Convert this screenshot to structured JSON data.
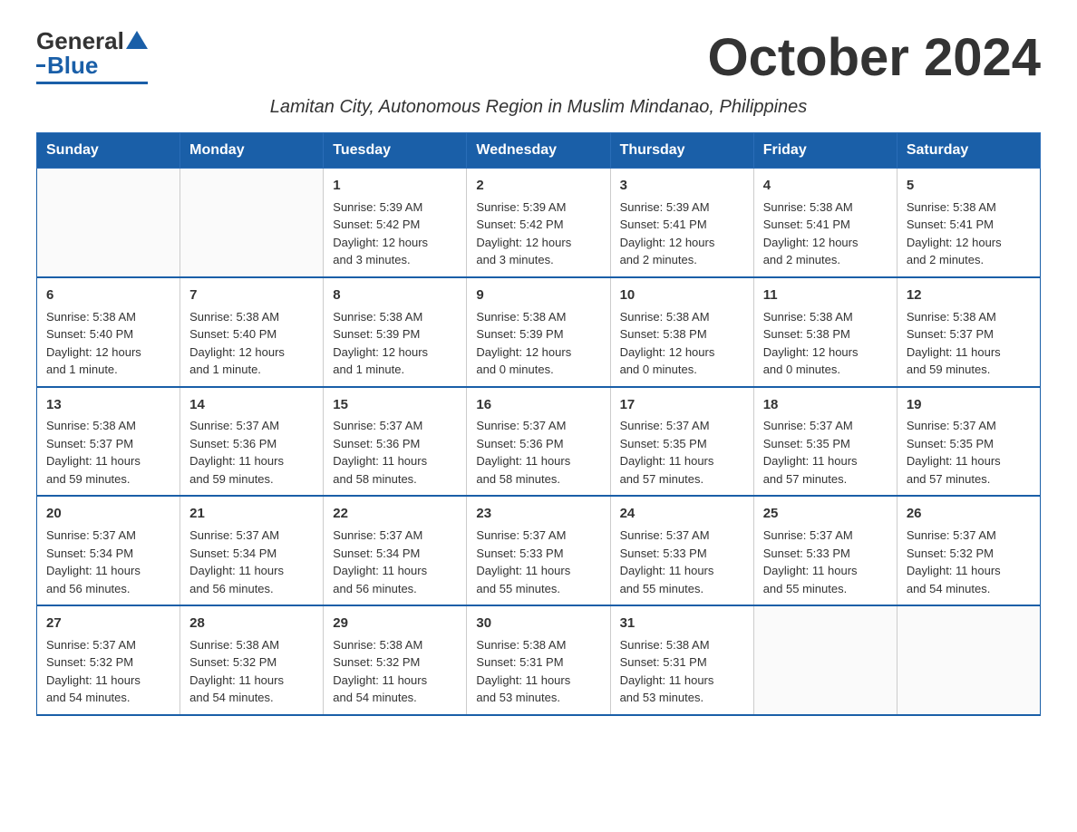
{
  "logo": {
    "general": "General",
    "blue": "Blue"
  },
  "title": "October 2024",
  "subtitle": "Lamitan City, Autonomous Region in Muslim Mindanao, Philippines",
  "weekdays": [
    "Sunday",
    "Monday",
    "Tuesday",
    "Wednesday",
    "Thursday",
    "Friday",
    "Saturday"
  ],
  "weeks": [
    [
      {
        "day": "",
        "info": ""
      },
      {
        "day": "",
        "info": ""
      },
      {
        "day": "1",
        "info": "Sunrise: 5:39 AM\nSunset: 5:42 PM\nDaylight: 12 hours\nand 3 minutes."
      },
      {
        "day": "2",
        "info": "Sunrise: 5:39 AM\nSunset: 5:42 PM\nDaylight: 12 hours\nand 3 minutes."
      },
      {
        "day": "3",
        "info": "Sunrise: 5:39 AM\nSunset: 5:41 PM\nDaylight: 12 hours\nand 2 minutes."
      },
      {
        "day": "4",
        "info": "Sunrise: 5:38 AM\nSunset: 5:41 PM\nDaylight: 12 hours\nand 2 minutes."
      },
      {
        "day": "5",
        "info": "Sunrise: 5:38 AM\nSunset: 5:41 PM\nDaylight: 12 hours\nand 2 minutes."
      }
    ],
    [
      {
        "day": "6",
        "info": "Sunrise: 5:38 AM\nSunset: 5:40 PM\nDaylight: 12 hours\nand 1 minute."
      },
      {
        "day": "7",
        "info": "Sunrise: 5:38 AM\nSunset: 5:40 PM\nDaylight: 12 hours\nand 1 minute."
      },
      {
        "day": "8",
        "info": "Sunrise: 5:38 AM\nSunset: 5:39 PM\nDaylight: 12 hours\nand 1 minute."
      },
      {
        "day": "9",
        "info": "Sunrise: 5:38 AM\nSunset: 5:39 PM\nDaylight: 12 hours\nand 0 minutes."
      },
      {
        "day": "10",
        "info": "Sunrise: 5:38 AM\nSunset: 5:38 PM\nDaylight: 12 hours\nand 0 minutes."
      },
      {
        "day": "11",
        "info": "Sunrise: 5:38 AM\nSunset: 5:38 PM\nDaylight: 12 hours\nand 0 minutes."
      },
      {
        "day": "12",
        "info": "Sunrise: 5:38 AM\nSunset: 5:37 PM\nDaylight: 11 hours\nand 59 minutes."
      }
    ],
    [
      {
        "day": "13",
        "info": "Sunrise: 5:38 AM\nSunset: 5:37 PM\nDaylight: 11 hours\nand 59 minutes."
      },
      {
        "day": "14",
        "info": "Sunrise: 5:37 AM\nSunset: 5:36 PM\nDaylight: 11 hours\nand 59 minutes."
      },
      {
        "day": "15",
        "info": "Sunrise: 5:37 AM\nSunset: 5:36 PM\nDaylight: 11 hours\nand 58 minutes."
      },
      {
        "day": "16",
        "info": "Sunrise: 5:37 AM\nSunset: 5:36 PM\nDaylight: 11 hours\nand 58 minutes."
      },
      {
        "day": "17",
        "info": "Sunrise: 5:37 AM\nSunset: 5:35 PM\nDaylight: 11 hours\nand 57 minutes."
      },
      {
        "day": "18",
        "info": "Sunrise: 5:37 AM\nSunset: 5:35 PM\nDaylight: 11 hours\nand 57 minutes."
      },
      {
        "day": "19",
        "info": "Sunrise: 5:37 AM\nSunset: 5:35 PM\nDaylight: 11 hours\nand 57 minutes."
      }
    ],
    [
      {
        "day": "20",
        "info": "Sunrise: 5:37 AM\nSunset: 5:34 PM\nDaylight: 11 hours\nand 56 minutes."
      },
      {
        "day": "21",
        "info": "Sunrise: 5:37 AM\nSunset: 5:34 PM\nDaylight: 11 hours\nand 56 minutes."
      },
      {
        "day": "22",
        "info": "Sunrise: 5:37 AM\nSunset: 5:34 PM\nDaylight: 11 hours\nand 56 minutes."
      },
      {
        "day": "23",
        "info": "Sunrise: 5:37 AM\nSunset: 5:33 PM\nDaylight: 11 hours\nand 55 minutes."
      },
      {
        "day": "24",
        "info": "Sunrise: 5:37 AM\nSunset: 5:33 PM\nDaylight: 11 hours\nand 55 minutes."
      },
      {
        "day": "25",
        "info": "Sunrise: 5:37 AM\nSunset: 5:33 PM\nDaylight: 11 hours\nand 55 minutes."
      },
      {
        "day": "26",
        "info": "Sunrise: 5:37 AM\nSunset: 5:32 PM\nDaylight: 11 hours\nand 54 minutes."
      }
    ],
    [
      {
        "day": "27",
        "info": "Sunrise: 5:37 AM\nSunset: 5:32 PM\nDaylight: 11 hours\nand 54 minutes."
      },
      {
        "day": "28",
        "info": "Sunrise: 5:38 AM\nSunset: 5:32 PM\nDaylight: 11 hours\nand 54 minutes."
      },
      {
        "day": "29",
        "info": "Sunrise: 5:38 AM\nSunset: 5:32 PM\nDaylight: 11 hours\nand 54 minutes."
      },
      {
        "day": "30",
        "info": "Sunrise: 5:38 AM\nSunset: 5:31 PM\nDaylight: 11 hours\nand 53 minutes."
      },
      {
        "day": "31",
        "info": "Sunrise: 5:38 AM\nSunset: 5:31 PM\nDaylight: 11 hours\nand 53 minutes."
      },
      {
        "day": "",
        "info": ""
      },
      {
        "day": "",
        "info": ""
      }
    ]
  ]
}
